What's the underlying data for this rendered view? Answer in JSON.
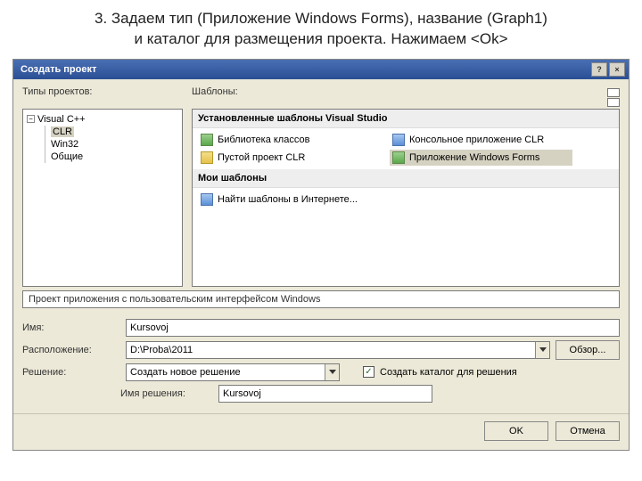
{
  "caption_line1": "3. Задаем тип (Приложение Windows Forms), название (Graph1)",
  "caption_line2": "и каталог для размещения проекта. Нажимаем <Ok>",
  "dialog": {
    "title": "Создать проект",
    "help_btn": "?",
    "close_btn": "×"
  },
  "labels": {
    "project_types": "Типы проектов:",
    "templates": "Шаблоны:",
    "name": "Имя:",
    "location": "Расположение:",
    "solution": "Решение:",
    "solution_name": "Имя решения:",
    "browse": "Обзор...",
    "ok": "OK",
    "cancel": "Отмена",
    "create_dir": "Создать каталог для решения"
  },
  "tree": {
    "root": "Visual C++",
    "items": [
      "CLR",
      "Win32",
      "Общие"
    ],
    "selected": "CLR"
  },
  "templates": {
    "installed_header": "Установленные шаблоны Visual Studio",
    "my_header": "Мои шаблоны",
    "items": [
      {
        "label": "Библиотека классов",
        "selected": false
      },
      {
        "label": "Консольное приложение CLR",
        "selected": false
      },
      {
        "label": "Пустой проект CLR",
        "selected": false
      },
      {
        "label": "Приложение Windows Forms",
        "selected": true
      }
    ],
    "my_items": [
      {
        "label": "Найти шаблоны в Интернете...",
        "selected": false
      }
    ]
  },
  "description": "Проект приложения с пользовательским интерфейсом Windows",
  "form": {
    "name_value": "Kursovoj",
    "location_value": "D:\\Proba\\2011",
    "solution_value": "Создать новое решение",
    "solution_name_value": "Kursovoj",
    "create_dir_checked": "✓"
  }
}
